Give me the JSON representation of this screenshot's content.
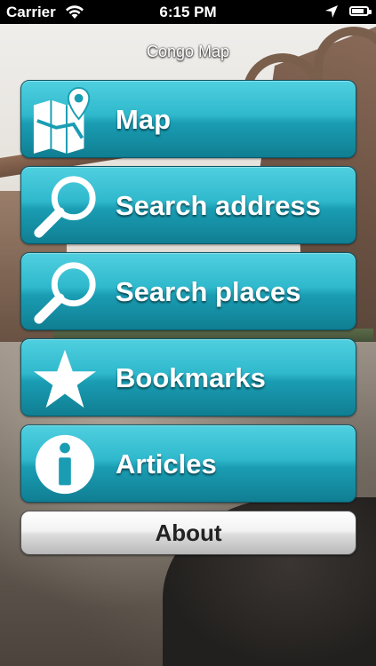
{
  "status_bar": {
    "carrier": "Carrier",
    "time": "6:15 PM",
    "battery_level": 0.9
  },
  "app": {
    "title": "Congo Map"
  },
  "menu": [
    {
      "label": "Map",
      "icon": "map-pin-icon"
    },
    {
      "label": "Search address",
      "icon": "magnifier-icon"
    },
    {
      "label": "Search places",
      "icon": "magnifier-icon"
    },
    {
      "label": "Bookmarks",
      "icon": "star-icon"
    },
    {
      "label": "Articles",
      "icon": "info-icon"
    }
  ],
  "about": {
    "label": "About"
  },
  "colors": {
    "button_accent": "#2fb8cc",
    "status_bar": "#000000"
  }
}
